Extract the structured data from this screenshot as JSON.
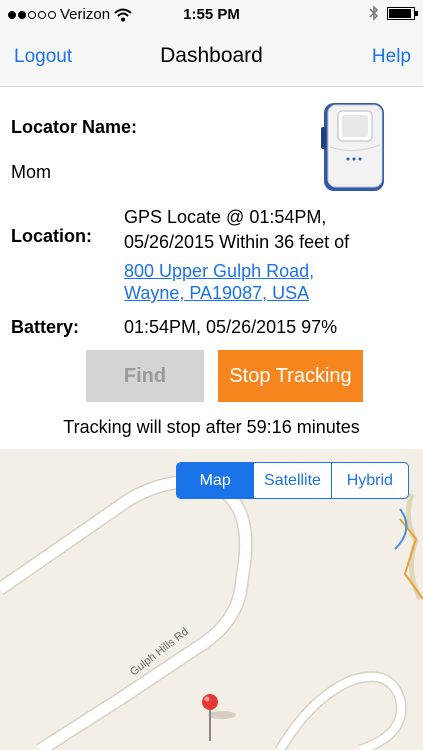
{
  "status": {
    "carrier": "Verizon",
    "time": "1:55 PM",
    "signal_filled": 2,
    "signal_total": 5,
    "icons": [
      "signal-dots-icon",
      "wifi-icon",
      "bluetooth-icon",
      "battery-icon"
    ],
    "battery_level": 0.9
  },
  "nav": {
    "left": "Logout",
    "title": "Dashboard",
    "right": "Help"
  },
  "locator": {
    "name_label": "Locator Name:",
    "name_value": "Mom",
    "location_label": "Location:",
    "location_line1": "GPS Locate @ 01:54PM,",
    "location_line2": "05/26/2015 Within 36 feet of",
    "address_line1": "800 Upper Gulph Road,",
    "address_line2": "Wayne, PA19087, USA",
    "battery_label": "Battery:",
    "battery_value": "01:54PM, 05/26/2015 97%"
  },
  "buttons": {
    "find": "Find",
    "stop": "Stop Tracking"
  },
  "countdown": "Tracking will stop after 59:16 minutes",
  "map": {
    "tabs": [
      "Map",
      "Satellite",
      "Hybrid"
    ],
    "active_tab": "Map",
    "road_label": "Gulph Hills Rd",
    "colors": {
      "accent": "#1a73e8",
      "stop": "#f7851d",
      "pin": "#e53935"
    }
  }
}
